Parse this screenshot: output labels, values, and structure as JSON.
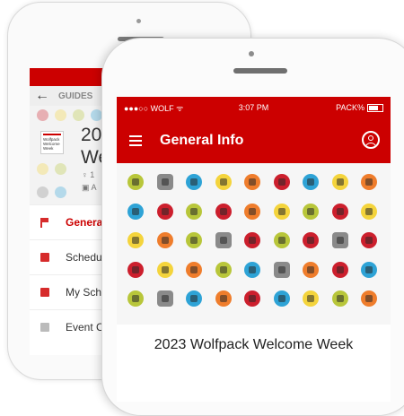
{
  "back_phone": {
    "nav": {
      "back_label": "GUIDES"
    },
    "guide": {
      "logo_lines": [
        "Wolfpack",
        "Welcome",
        "Week"
      ],
      "title_line1": "20",
      "title_line2": "We",
      "sub1": "♀ 1",
      "sub2": "▣ A"
    },
    "menu": [
      {
        "label": "General",
        "icon": "flag-icon",
        "active": true
      },
      {
        "label": "Schedu",
        "icon": "calendar-icon",
        "active": false
      },
      {
        "label": "My Sch",
        "icon": "calendar-check-icon",
        "active": false
      },
      {
        "label": "Event C",
        "icon": "folder-icon",
        "active": false
      }
    ]
  },
  "front_phone": {
    "status": {
      "carrier": "●●●○○ WOLF ᯤ",
      "time": "3:07 PM",
      "battery": "PACK%"
    },
    "app_bar": {
      "title": "General Info"
    },
    "guide_name": "2023 Wolfpack Welcome Week",
    "pattern_colors": [
      "#b8c63a",
      "#8a8a8a",
      "#2ea3d6",
      "#f4d43c",
      "#ef7d2c",
      "#cc1f2d"
    ],
    "pattern_rows": [
      [
        "#b8c63a",
        "#8a8a8a",
        "#2ea3d6",
        "#f4d43c",
        "#ef7d2c",
        "#cc1f2d",
        "#2ea3d6",
        "#f4d43c",
        "#ef7d2c"
      ],
      [
        "#2ea3d6",
        "#cc1f2d",
        "#b8c63a",
        "#cc1f2d",
        "#ef7d2c",
        "#f4d43c",
        "#b8c63a",
        "#cc1f2d",
        "#f4d43c"
      ],
      [
        "#f4d43c",
        "#ef7d2c",
        "#b8c63a",
        "#8a8a8a",
        "#cc1f2d",
        "#b8c63a",
        "#cc1f2d",
        "#8a8a8a",
        "#cc1f2d"
      ],
      [
        "#cc1f2d",
        "#f4d43c",
        "#ef7d2c",
        "#b8c63a",
        "#2ea3d6",
        "#8a8a8a",
        "#ef7d2c",
        "#cc1f2d",
        "#2ea3d6"
      ],
      [
        "#b8c63a",
        "#8a8a8a",
        "#2ea3d6",
        "#ef7d2c",
        "#cc1f2d",
        "#2ea3d6",
        "#f4d43c",
        "#b8c63a",
        "#ef7d2c"
      ]
    ]
  }
}
